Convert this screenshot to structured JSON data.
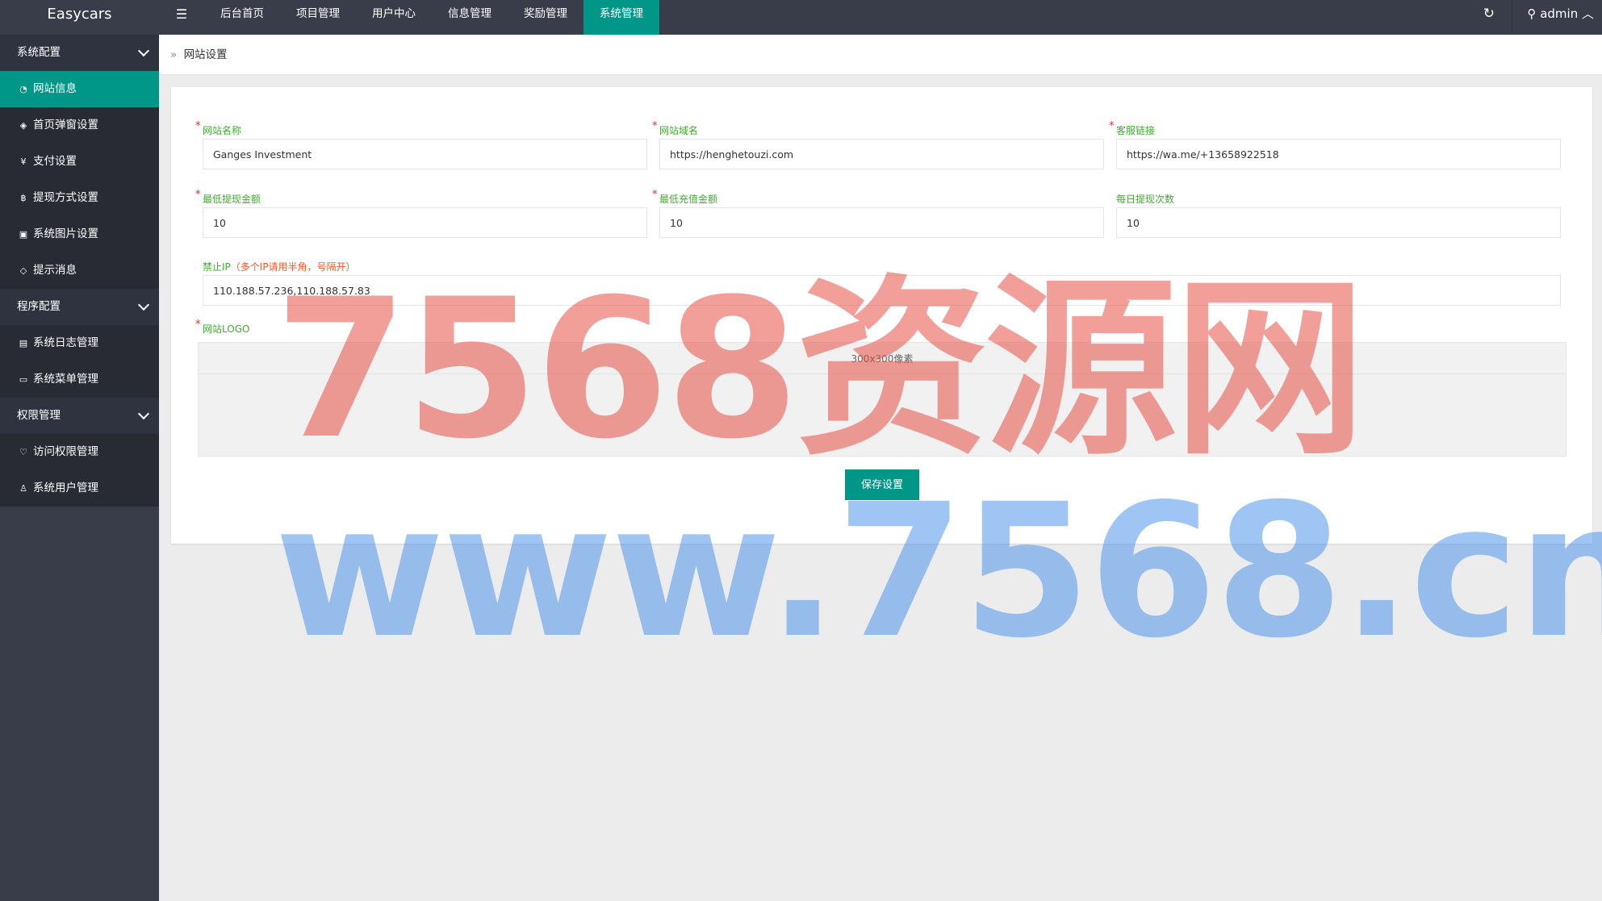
{
  "app": {
    "brand": "Easycars",
    "menu_toggle_icon": "☰"
  },
  "topnav": {
    "items": [
      {
        "label": "后台首页",
        "active": false
      },
      {
        "label": "项目管理",
        "active": false
      },
      {
        "label": "用户中心",
        "active": false
      },
      {
        "label": "信息管理",
        "active": false
      },
      {
        "label": "奖励管理",
        "active": false
      },
      {
        "label": "系统管理",
        "active": true
      }
    ],
    "refresh_icon": "↻",
    "user_icon": "⚲",
    "user": "admin",
    "user_chevron": "︿"
  },
  "sidebar": {
    "groups": [
      {
        "label": "系统配置",
        "items": [
          {
            "label": "网站信息",
            "icon": "◔",
            "active": true
          },
          {
            "label": "首页弹窗设置",
            "icon": "◈",
            "active": false
          },
          {
            "label": "支付设置",
            "icon": "¥",
            "active": false
          },
          {
            "label": "提现方式设置",
            "icon": "฿",
            "active": false
          },
          {
            "label": "系统图片设置",
            "icon": "▣",
            "active": false
          },
          {
            "label": "提示消息",
            "icon": "◇",
            "active": false
          }
        ]
      },
      {
        "label": "程序配置",
        "items": [
          {
            "label": "系统日志管理",
            "icon": "▤",
            "active": false
          },
          {
            "label": "系统菜单管理",
            "icon": "▭",
            "active": false
          }
        ]
      },
      {
        "label": "权限管理",
        "items": [
          {
            "label": "访问权限管理",
            "icon": "♡",
            "active": false
          },
          {
            "label": "系统用户管理",
            "icon": "♙",
            "active": false
          }
        ]
      }
    ]
  },
  "breadcrumb": {
    "separator": "»",
    "current": "网站设置"
  },
  "form": {
    "site_name": {
      "label": "网站名称",
      "value": "Ganges Investment"
    },
    "site_domain": {
      "label": "网站域名",
      "value": "https://henghetouzi.com"
    },
    "service_link": {
      "label": "客服链接",
      "value": "https://wa.me/+13658922518"
    },
    "min_withdraw": {
      "label": "最低提现金额",
      "value": "10"
    },
    "min_recharge": {
      "label": "最低充值金额",
      "value": "10"
    },
    "daily_withdraw": {
      "label": "每日提现次数",
      "value": "10"
    },
    "banned_ip": {
      "label": "禁止IP",
      "hint": "（多个IP请用半角，号隔开）",
      "value": "110.188.57.236,110.188.57.83"
    },
    "logo": {
      "label": "网站LOGO",
      "size_hint": "300x300像素"
    },
    "save_label": "保存设置"
  },
  "watermark": {
    "line1": "7568资源网",
    "line2": "www.7568.cn"
  },
  "colors": {
    "accent": "#009688",
    "header_bg": "#393d49",
    "label_green": "#3fad2f",
    "required_red": "#ff2222"
  }
}
